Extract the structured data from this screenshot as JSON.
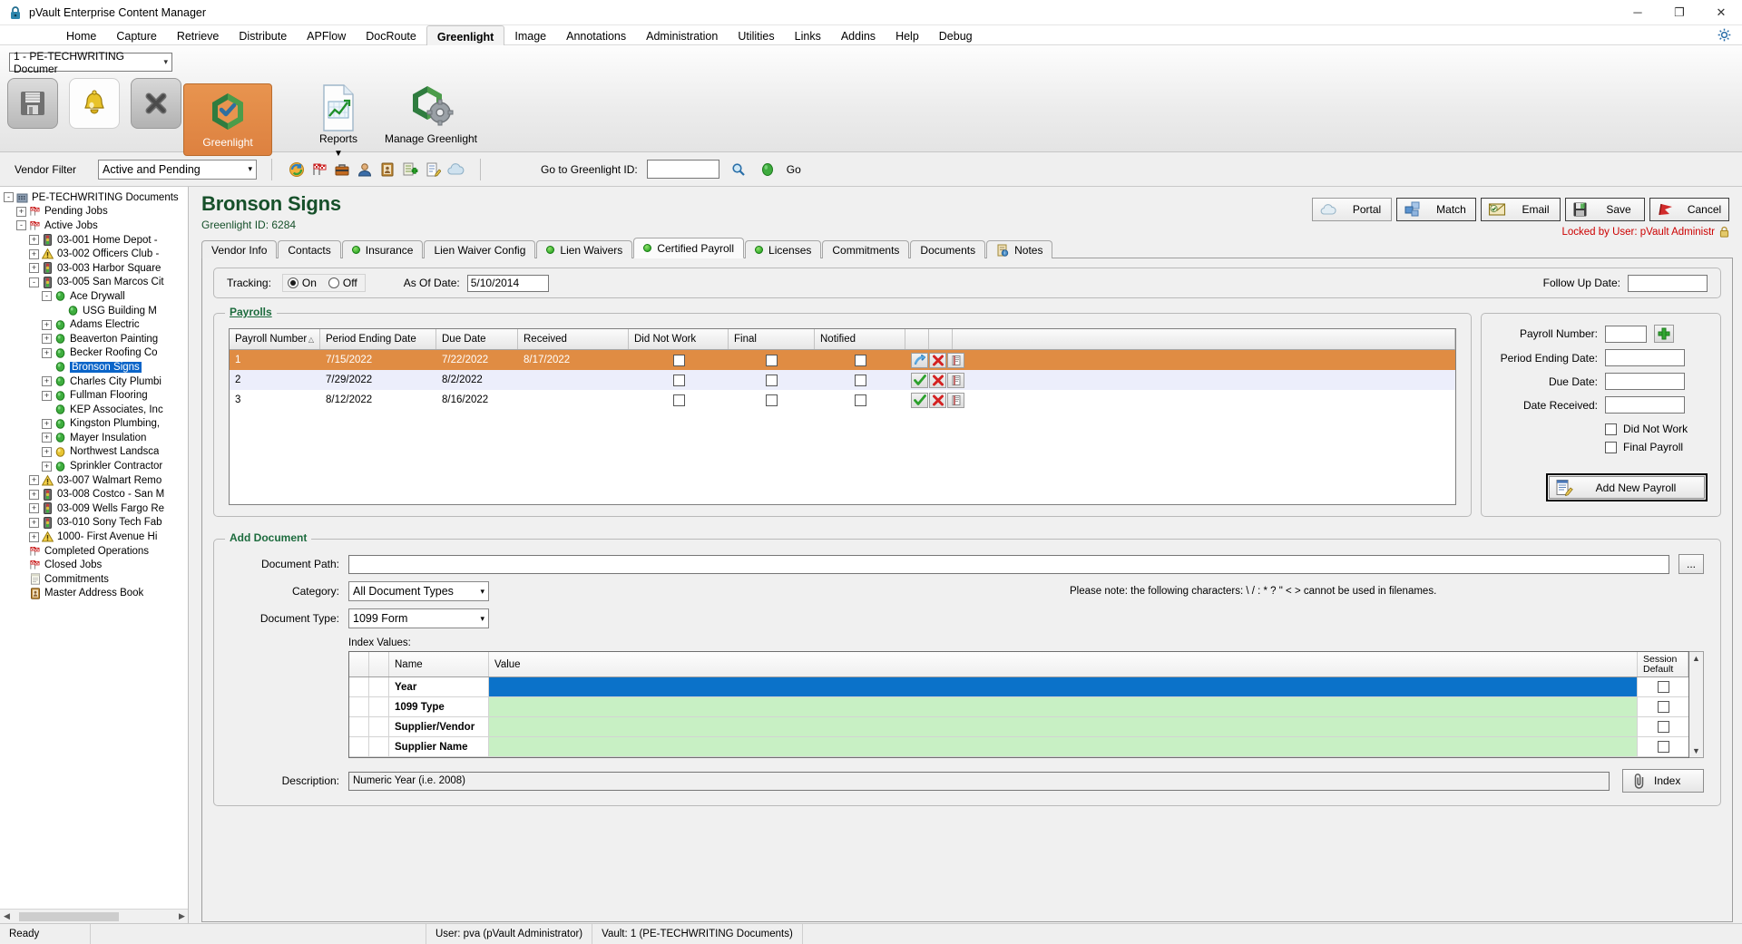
{
  "window": {
    "title": "pVault Enterprise Content Manager",
    "minimize": "─",
    "maximize": "❐",
    "close": "✕"
  },
  "menu": {
    "items": [
      "Home",
      "Capture",
      "Retrieve",
      "Distribute",
      "APFlow",
      "DocRoute",
      "Greenlight",
      "Image",
      "Annotations",
      "Administration",
      "Utilities",
      "Links",
      "Addins",
      "Help",
      "Debug"
    ],
    "active": "Greenlight"
  },
  "ribbon": {
    "vault_selector": "1 - PE-TECHWRITING Documer",
    "quick_icons": [
      "save-icon",
      "bell-icon",
      "cancel-icon"
    ],
    "buttons": [
      {
        "label": "Greenlight",
        "icon": "greenlight-hex-icon"
      },
      {
        "label": "Reports",
        "icon": "report-chart-icon"
      },
      {
        "label": "Manage Greenlight",
        "icon": "manage-greenlight-icon"
      }
    ]
  },
  "filterbar": {
    "vendor_filter_label": "Vendor Filter",
    "vendor_filter_value": "Active and Pending",
    "goto_label": "Go to Greenlight ID:",
    "goto_value": "",
    "go_label": "Go",
    "icons": [
      "refresh-icon",
      "flags-icon",
      "toolbox-icon",
      "person-icon",
      "address-book-icon",
      "add-record-icon",
      "edit-note-icon",
      "cloud-icon"
    ]
  },
  "sidebar": {
    "nodes": [
      {
        "label": "PE-TECHWRITING Documents",
        "indent": 0,
        "exp": "-",
        "icon": "vault-icon"
      },
      {
        "label": "Pending Jobs",
        "indent": 1,
        "exp": "+",
        "icon": "flags-icon"
      },
      {
        "label": "Active Jobs",
        "indent": 1,
        "exp": "-",
        "icon": "flags-icon"
      },
      {
        "label": "03-001  Home Depot -",
        "indent": 2,
        "exp": "+",
        "icon": "traffic-light-icon"
      },
      {
        "label": "03-002  Officers Club -",
        "indent": 2,
        "exp": "+",
        "icon": "warning-icon"
      },
      {
        "label": "03-003  Harbor Square",
        "indent": 2,
        "exp": "+",
        "icon": "traffic-light-icon"
      },
      {
        "label": "03-005  San Marcos Cit",
        "indent": 2,
        "exp": "-",
        "icon": "traffic-light-icon"
      },
      {
        "label": "Ace Drywall",
        "indent": 3,
        "exp": "-",
        "icon": "green-dot-icon"
      },
      {
        "label": "USG Building M",
        "indent": 4,
        "exp": "",
        "icon": "green-dot-icon"
      },
      {
        "label": "Adams Electric",
        "indent": 3,
        "exp": "+",
        "icon": "green-dot-icon"
      },
      {
        "label": "Beaverton Painting",
        "indent": 3,
        "exp": "+",
        "icon": "green-dot-icon"
      },
      {
        "label": "Becker Roofing Co",
        "indent": 3,
        "exp": "+",
        "icon": "green-dot-icon"
      },
      {
        "label": "Bronson Signs",
        "indent": 3,
        "exp": "",
        "icon": "green-dot-icon",
        "selected": true
      },
      {
        "label": "Charles City Plumbi",
        "indent": 3,
        "exp": "+",
        "icon": "green-dot-icon"
      },
      {
        "label": "Fullman Flooring",
        "indent": 3,
        "exp": "+",
        "icon": "green-dot-icon"
      },
      {
        "label": "KEP Associates, Inc",
        "indent": 3,
        "exp": "",
        "icon": "green-dot-icon"
      },
      {
        "label": "Kingston Plumbing,",
        "indent": 3,
        "exp": "+",
        "icon": "green-dot-icon"
      },
      {
        "label": "Mayer Insulation",
        "indent": 3,
        "exp": "+",
        "icon": "green-dot-icon"
      },
      {
        "label": "Northwest Landsca",
        "indent": 3,
        "exp": "+",
        "icon": "yellow-dot-icon"
      },
      {
        "label": "Sprinkler Contractor",
        "indent": 3,
        "exp": "+",
        "icon": "green-dot-icon"
      },
      {
        "label": "03-007  Walmart Remo",
        "indent": 2,
        "exp": "+",
        "icon": "warning-icon"
      },
      {
        "label": "03-008  Costco - San M",
        "indent": 2,
        "exp": "+",
        "icon": "traffic-light-icon"
      },
      {
        "label": "03-009  Wells Fargo Re",
        "indent": 2,
        "exp": "+",
        "icon": "traffic-light-icon"
      },
      {
        "label": "03-010  Sony Tech Fab",
        "indent": 2,
        "exp": "+",
        "icon": "traffic-light-icon"
      },
      {
        "label": "1000-  First  Avenue Hi",
        "indent": 2,
        "exp": "+",
        "icon": "warning-icon"
      },
      {
        "label": "Completed Operations",
        "indent": 1,
        "exp": "",
        "icon": "flags-icon"
      },
      {
        "label": "Closed Jobs",
        "indent": 1,
        "exp": "",
        "icon": "flags-icon"
      },
      {
        "label": "Commitments",
        "indent": 1,
        "exp": "",
        "icon": "po-icon"
      },
      {
        "label": "Master Address Book",
        "indent": 1,
        "exp": "",
        "icon": "address-book-icon"
      }
    ]
  },
  "header": {
    "vendor_name": "Bronson Signs",
    "greenlight_id_label": "Greenlight ID: 6284",
    "locked_text": "Locked by User: pVault Administr",
    "buttons": [
      {
        "label": "Portal",
        "icon": "cloud-icon"
      },
      {
        "label": "Match",
        "icon": "match-blocks-icon"
      },
      {
        "label": "Email",
        "icon": "email-envelope-icon"
      },
      {
        "label": "Save",
        "icon": "save-disk-icon"
      },
      {
        "label": "Cancel",
        "icon": "cancel-flag-icon"
      }
    ]
  },
  "tabs": [
    {
      "label": "Vendor Info",
      "dot": false,
      "active": false
    },
    {
      "label": "Contacts",
      "dot": false,
      "active": false
    },
    {
      "label": "Insurance",
      "dot": true,
      "active": false
    },
    {
      "label": "Lien Waiver Config",
      "dot": false,
      "active": false
    },
    {
      "label": "Lien Waivers",
      "dot": true,
      "active": false
    },
    {
      "label": "Certified Payroll",
      "dot": true,
      "active": true
    },
    {
      "label": "Licenses",
      "dot": true,
      "active": false
    },
    {
      "label": "Commitments",
      "dot": false,
      "active": false
    },
    {
      "label": "Documents",
      "dot": false,
      "active": false
    },
    {
      "label": "Notes",
      "dot": false,
      "active": false,
      "icon": "notes-icon"
    }
  ],
  "tracking": {
    "label": "Tracking:",
    "on_label": "On",
    "off_label": "Off",
    "selected": "On",
    "as_of_label": "As Of Date:",
    "as_of_value": "5/10/2014",
    "follow_up_label": "Follow Up Date:",
    "follow_up_value": ""
  },
  "payrolls": {
    "legend": "Payrolls",
    "columns": [
      "Payroll Number",
      "Period Ending Date",
      "Due Date",
      "Received",
      "Did Not Work",
      "Final",
      "Notified",
      "",
      "",
      ""
    ],
    "sort_column": "Payroll Number",
    "rows": [
      {
        "number": "1",
        "period_ending": "7/15/2022",
        "due": "7/22/2022",
        "received": "8/17/2022",
        "did_not_work": false,
        "final": false,
        "notified": false,
        "selected": true,
        "first_icon": "upload-arrow-icon"
      },
      {
        "number": "2",
        "period_ending": "7/29/2022",
        "due": "8/2/2022",
        "received": "",
        "did_not_work": false,
        "final": false,
        "notified": false,
        "selected": false,
        "first_icon": "check-icon"
      },
      {
        "number": "3",
        "period_ending": "8/12/2022",
        "due": "8/16/2022",
        "received": "",
        "did_not_work": false,
        "final": false,
        "notified": false,
        "selected": false,
        "first_icon": "check-icon"
      }
    ]
  },
  "payroll_form": {
    "fields": [
      {
        "label": "Payroll Number:",
        "value": ""
      },
      {
        "label": "Period Ending Date:",
        "value": ""
      },
      {
        "label": "Due Date:",
        "value": ""
      },
      {
        "label": "Date Received:",
        "value": ""
      }
    ],
    "add_icon": "plus-icon",
    "checks": [
      {
        "label": "Did Not Work",
        "checked": false
      },
      {
        "label": "Final Payroll",
        "checked": false
      }
    ],
    "add_button": "Add  New Payroll",
    "add_button_icon": "add-payroll-icon"
  },
  "add_document": {
    "legend": "Add Document",
    "document_path_label": "Document Path:",
    "document_path_value": "",
    "browse_label": "...",
    "category_label": "Category:",
    "category_value": "All Document Types",
    "doc_type_label": "Document Type:",
    "doc_type_value": "1099 Form",
    "note": "Please note:  the following characters:  \\ / : * ? \" < > cannot be used in filenames.",
    "index_values_label": "Index Values:",
    "index_columns": [
      "",
      "",
      "Name",
      "Value",
      "Session\nDefault"
    ],
    "index_rows": [
      {
        "name": "Year",
        "value": "",
        "session_default": false,
        "highlighted": true
      },
      {
        "name": "1099 Type",
        "value": "",
        "session_default": false,
        "highlighted": false
      },
      {
        "name": "Supplier/Vendor",
        "value": "",
        "session_default": false,
        "highlighted": false
      },
      {
        "name": "Supplier Name",
        "value": "",
        "session_default": false,
        "highlighted": false
      }
    ],
    "description_label": "Description:",
    "description_value": "Numeric Year (i.e. 2008)",
    "index_button": "Index",
    "index_button_icon": "paperclip-icon"
  },
  "statusbar": {
    "ready": "Ready",
    "user": "User: pva (pVault Administrator)",
    "vault": "Vault: 1 (PE-TECHWRITING Documents)"
  },
  "colors": {
    "accent_orange": "#e08c43",
    "green_title": "#16502a",
    "locked_red": "#cc0000",
    "row_highlight_blue": "#0b72c9",
    "row_green": "#c8f0c4"
  }
}
